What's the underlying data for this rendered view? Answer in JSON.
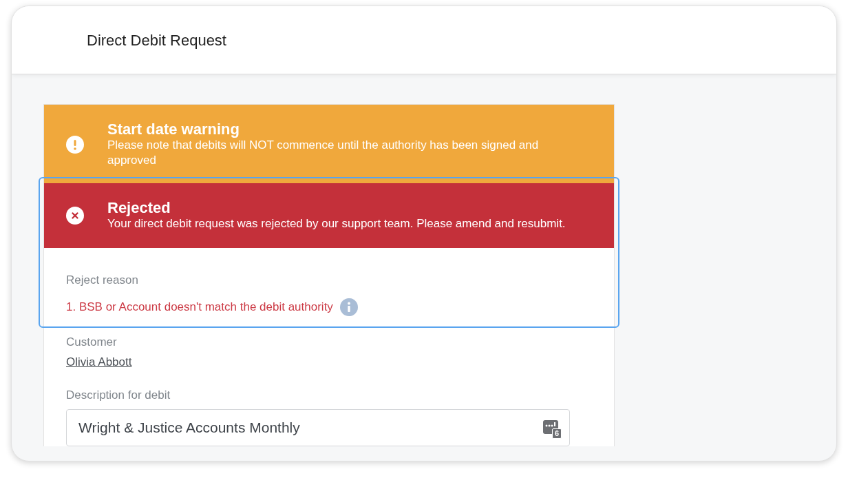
{
  "window": {
    "title": "Direct Debit Request"
  },
  "alerts": [
    {
      "kind": "warning",
      "title": "Start date warning",
      "message": "Please note that debits will NOT commence until the authority has been signed and approved",
      "highlighted": false
    },
    {
      "kind": "error",
      "title": "Rejected",
      "message": "Your direct debit request was rejected by our support team. Please amend and resubmit.",
      "highlighted": true
    }
  ],
  "reject_reason": {
    "label": "Reject reason",
    "reasons": [
      "1. BSB or Account doesn't match the debit authority"
    ]
  },
  "customer": {
    "label": "Customer",
    "name": "Olivia Abbott"
  },
  "description": {
    "label": "Description for debit",
    "value": "Wright & Justice Accounts Monthly",
    "badge": "6"
  }
}
